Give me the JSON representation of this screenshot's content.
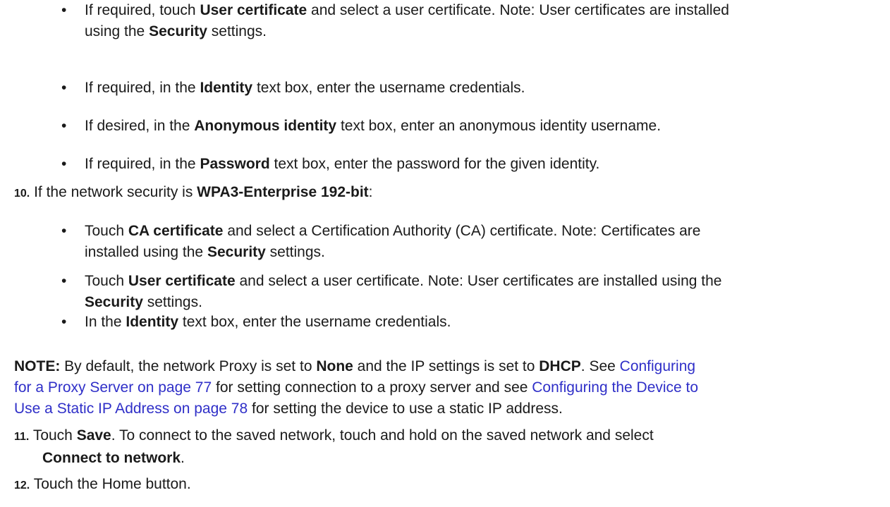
{
  "b1": {
    "p1": "If required, touch ",
    "b1": "User certificate",
    "p2": " and select a user certificate. Note: User certificates are installed",
    "p3": "using the ",
    "b2": "Security",
    "p4": " settings."
  },
  "b2": {
    "p1": "If required, in the ",
    "b1": "Identity",
    "p2": " text box, enter the username credentials."
  },
  "b3": {
    "p1": "If desired, in the ",
    "b1": "Anonymous identity",
    "p2": " text box, enter an anonymous identity username."
  },
  "b4": {
    "p1": "If required, in the ",
    "b1": "Password",
    "p2": " text box, enter the password for the given identity."
  },
  "step10": {
    "num": "10.",
    "p1": " If the network security is ",
    "b1": "WPA3-Enterprise 192-bit",
    "p2": ":"
  },
  "b5": {
    "p1": "Touch ",
    "b1": "CA certificate",
    "p2": " and select a Certification Authority (CA) certificate. Note: Certificates are",
    "p3": "installed using the ",
    "b2": "Security",
    "p4": " settings."
  },
  "b6": {
    "p1": "Touch ",
    "b1": "User certificate",
    "p2": " and select a user certificate. Note: User certificates are installed using the",
    "b2": "Security",
    "p3": " settings."
  },
  "b7": {
    "p1": "In the ",
    "b1": "Identity",
    "p2": " text box, enter the username credentials."
  },
  "note": {
    "label": "NOTE:",
    "p1": " By default, the network Proxy is set to ",
    "b1": "None",
    "p2": " and the IP settings is set to ",
    "b2": "DHCP",
    "p3": ". See ",
    "link1a": "Configuring",
    "link1b": "for a Proxy Server on page 77",
    "p4": " for setting connection to a proxy server and see ",
    "link2a": "Configuring the Device to",
    "link2b": "Use a Static IP Address on page 78",
    "p5": " for setting the device to use a static IP address."
  },
  "step11": {
    "num": "11.",
    "p1": " Touch ",
    "b1": "Save",
    "p2": ". To connect to the saved network, touch and hold on the saved network and select",
    "b2": "Connect to network",
    "p3": "."
  },
  "step12": {
    "num": "12.",
    "p1": " Touch the Home button."
  },
  "bullet_char": "•"
}
